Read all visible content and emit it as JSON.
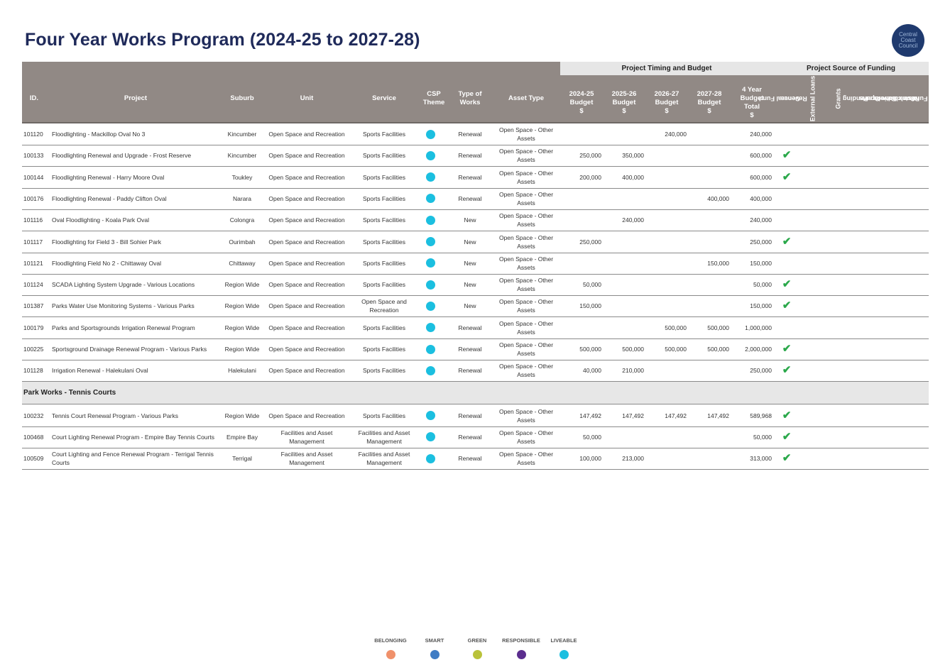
{
  "title": "Four Year Works Program (2024-25 to 2027-28)",
  "logo": {
    "lines": [
      "Central",
      "Coast",
      "Council"
    ]
  },
  "bands": {
    "timing": "Project Timing and Budget",
    "funding": "Project Source of Funding"
  },
  "headers": {
    "id": "ID.",
    "project": "Project",
    "suburb": "Suburb",
    "unit": "Unit",
    "service": "Service",
    "csp_theme": [
      "CSP",
      "Theme"
    ],
    "type_of_works": [
      "Type of",
      "Works"
    ],
    "asset_type": "Asset Type",
    "b2425": [
      "2024-25",
      "Budget",
      "$"
    ],
    "b2526": [
      "2025-26",
      "Budget",
      "$"
    ],
    "b2627": [
      "2026-27",
      "Budget",
      "$"
    ],
    "b2728": [
      "2027-28",
      "Budget",
      "$"
    ],
    "total": [
      "4 Year",
      "Budget",
      "Total",
      "$"
    ],
    "funding": [
      [
        "General Fund",
        "Revenue"
      ],
      [
        "External Loans"
      ],
      [
        "Grants"
      ],
      [
        "Pending",
        "Grants"
      ],
      [
        "Developer",
        "Contributions"
      ],
      [
        "Restricted",
        "Funds"
      ]
    ]
  },
  "tick_glyph": "✔",
  "colors": {
    "header_bg": "#918985",
    "liveable": "#1bbfe0",
    "tick": "#2aa84a",
    "title": "#1f2a5a"
  },
  "rows": [
    {
      "id": "101120",
      "project": "Floodlighting - Mackillop Oval No 3",
      "suburb": "Kincumber",
      "unit": "Open Space and Recreation",
      "service": "Sports Facilities",
      "theme": "liveable",
      "type": "Renewal",
      "asset": "Open Space - Other Assets",
      "b2425": "",
      "b2526": "",
      "b2627": "240,000",
      "b2728": "",
      "total": "240,000",
      "general_fund": false
    },
    {
      "id": "100133",
      "project": "Floodlighting Renewal and Upgrade - Frost Reserve",
      "suburb": "Kincumber",
      "unit": "Open Space and Recreation",
      "service": "Sports Facilities",
      "theme": "liveable",
      "type": "Renewal",
      "asset": "Open Space - Other Assets",
      "b2425": "250,000",
      "b2526": "350,000",
      "b2627": "",
      "b2728": "",
      "total": "600,000",
      "general_fund": true
    },
    {
      "id": "100144",
      "project": "Floodlighting Renewal - Harry Moore Oval",
      "suburb": "Toukley",
      "unit": "Open Space and Recreation",
      "service": "Sports Facilities",
      "theme": "liveable",
      "type": "Renewal",
      "asset": "Open Space - Other Assets",
      "b2425": "200,000",
      "b2526": "400,000",
      "b2627": "",
      "b2728": "",
      "total": "600,000",
      "general_fund": true
    },
    {
      "id": "100176",
      "project": "Floodlighting Renewal - Paddy Clifton Oval",
      "suburb": "Narara",
      "unit": "Open Space and Recreation",
      "service": "Sports Facilities",
      "theme": "liveable",
      "type": "Renewal",
      "asset": "Open Space - Other Assets",
      "b2425": "",
      "b2526": "",
      "b2627": "",
      "b2728": "400,000",
      "total": "400,000",
      "general_fund": false
    },
    {
      "id": "101116",
      "project": "Oval Floodlighting - Koala Park Oval",
      "suburb": "Colongra",
      "unit": "Open Space and Recreation",
      "service": "Sports Facilities",
      "theme": "liveable",
      "type": "New",
      "asset": "Open Space - Other Assets",
      "b2425": "",
      "b2526": "240,000",
      "b2627": "",
      "b2728": "",
      "total": "240,000",
      "general_fund": false
    },
    {
      "id": "101117",
      "project": "Floodlighting for Field 3 - Bill Sohier Park",
      "suburb": "Ourimbah",
      "unit": "Open Space and Recreation",
      "service": "Sports Facilities",
      "theme": "liveable",
      "type": "New",
      "asset": "Open Space - Other Assets",
      "b2425": "250,000",
      "b2526": "",
      "b2627": "",
      "b2728": "",
      "total": "250,000",
      "general_fund": true
    },
    {
      "id": "101121",
      "project": "Floodlighting Field No 2 - Chittaway Oval",
      "suburb": "Chittaway",
      "unit": "Open Space and Recreation",
      "service": "Sports Facilities",
      "theme": "liveable",
      "type": "New",
      "asset": "Open Space - Other Assets",
      "b2425": "",
      "b2526": "",
      "b2627": "",
      "b2728": "150,000",
      "total": "150,000",
      "general_fund": false
    },
    {
      "id": "101124",
      "project": "SCADA Lighting System Upgrade - Various Locations",
      "suburb": "Region Wide",
      "unit": "Open Space and Recreation",
      "service": "Sports Facilities",
      "theme": "liveable",
      "type": "New",
      "asset": "Open Space - Other Assets",
      "b2425": "50,000",
      "b2526": "",
      "b2627": "",
      "b2728": "",
      "total": "50,000",
      "general_fund": true
    },
    {
      "id": "101387",
      "project": "Parks Water Use Monitoring Systems - Various Parks",
      "suburb": "Region Wide",
      "unit": "Open Space and Recreation",
      "service": "Open Space and Recreation",
      "theme": "liveable",
      "type": "New",
      "asset": "Open Space - Other Assets",
      "b2425": "150,000",
      "b2526": "",
      "b2627": "",
      "b2728": "",
      "total": "150,000",
      "general_fund": true
    },
    {
      "id": "100179",
      "project": "Parks and Sportsgrounds Irrigation Renewal Program",
      "suburb": "Region Wide",
      "unit": "Open Space and Recreation",
      "service": "Sports Facilities",
      "theme": "liveable",
      "type": "Renewal",
      "asset": "Open Space - Other Assets",
      "b2425": "",
      "b2526": "",
      "b2627": "500,000",
      "b2728": "500,000",
      "total": "1,000,000",
      "general_fund": false
    },
    {
      "id": "100225",
      "project": "Sportsground Drainage Renewal Program - Various Parks",
      "suburb": "Region Wide",
      "unit": "Open Space and Recreation",
      "service": "Sports Facilities",
      "theme": "liveable",
      "type": "Renewal",
      "asset": "Open Space - Other Assets",
      "b2425": "500,000",
      "b2526": "500,000",
      "b2627": "500,000",
      "b2728": "500,000",
      "total": "2,000,000",
      "general_fund": true
    },
    {
      "id": "101128",
      "project": "Irrigation Renewal - Halekulani Oval",
      "suburb": "Halekulani",
      "unit": "Open Space and Recreation",
      "service": "Sports Facilities",
      "theme": "liveable",
      "type": "Renewal",
      "asset": "Open Space - Other Assets",
      "b2425": "40,000",
      "b2526": "210,000",
      "b2627": "",
      "b2728": "",
      "total": "250,000",
      "general_fund": true
    }
  ],
  "section2": {
    "title": "Park Works - Tennis Courts",
    "rows": [
      {
        "id": "100232",
        "project": "Tennis Court Renewal Program - Various Parks",
        "suburb": "Region Wide",
        "unit": "Open Space and Recreation",
        "service": "Sports Facilities",
        "theme": "liveable",
        "type": "Renewal",
        "asset": "Open Space - Other Assets",
        "b2425": "147,492",
        "b2526": "147,492",
        "b2627": "147,492",
        "b2728": "147,492",
        "total": "589,968",
        "general_fund": true
      },
      {
        "id": "100468",
        "project": "Court Lighting Renewal Program - Empire Bay Tennis Courts",
        "suburb": "Empire Bay",
        "unit": "Facilities and Asset Management",
        "service": "Facilities and Asset Management",
        "theme": "liveable",
        "type": "Renewal",
        "asset": "Open Space - Other Assets",
        "b2425": "50,000",
        "b2526": "",
        "b2627": "",
        "b2728": "",
        "total": "50,000",
        "general_fund": true
      },
      {
        "id": "100509",
        "project": "Court Lighting and Fence Renewal Program - Terrigal Tennis Courts",
        "suburb": "Terrigal",
        "unit": "Facilities and Asset Management",
        "service": "Facilities and Asset Management",
        "theme": "liveable",
        "type": "Renewal",
        "asset": "Open Space - Other Assets",
        "b2425": "100,000",
        "b2526": "213,000",
        "b2627": "",
        "b2728": "",
        "total": "313,000",
        "general_fund": true
      }
    ]
  },
  "legend": [
    {
      "label": "BELONGING",
      "color": "#f0916b"
    },
    {
      "label": "SMART",
      "color": "#3f7cc4"
    },
    {
      "label": "GREEN",
      "color": "#b9c23a"
    },
    {
      "label": "RESPONSIBLE",
      "color": "#5b2d8e"
    },
    {
      "label": "LIVEABLE",
      "color": "#1bbfe0"
    }
  ]
}
